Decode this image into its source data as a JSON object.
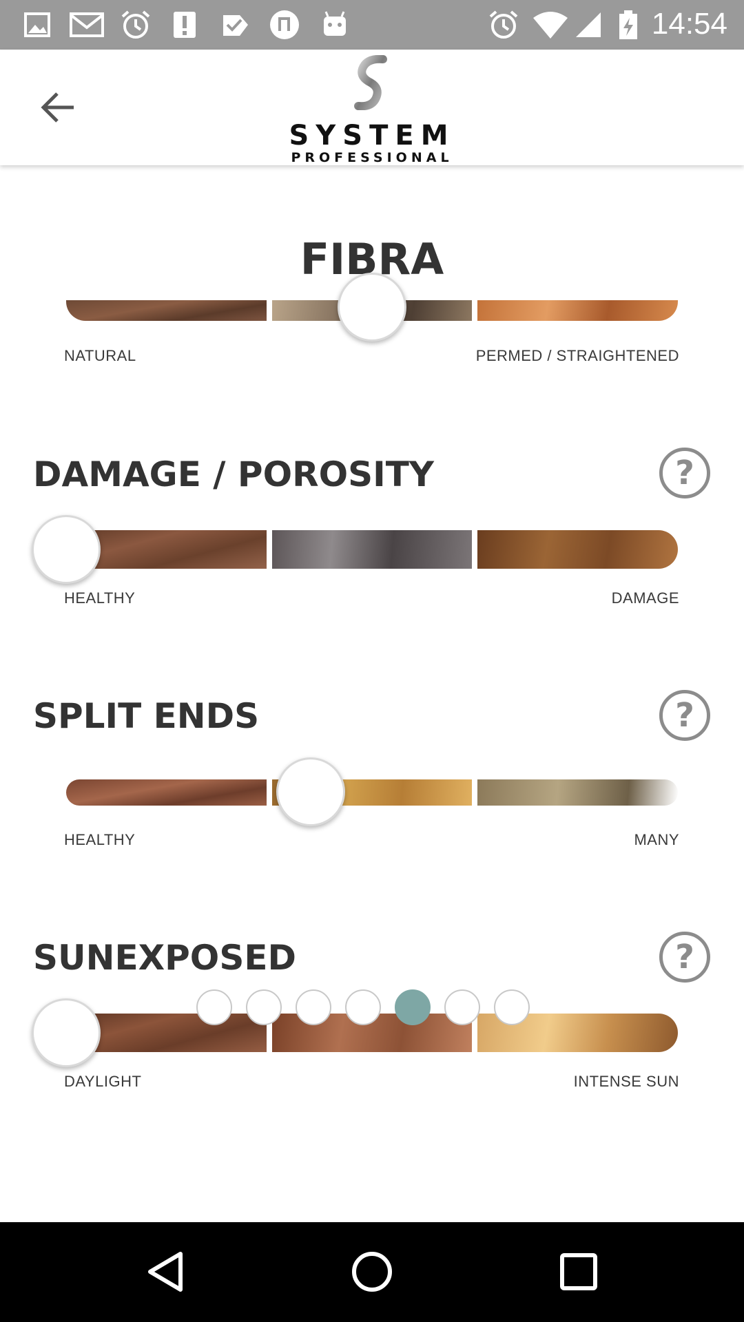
{
  "status_bar": {
    "time": "14:54",
    "left_icons": [
      "gallery-icon",
      "gmail-icon",
      "alarm-icon",
      "alert-icon",
      "check-icon",
      "music-icon",
      "android-icon"
    ],
    "right_icons": [
      "alarm-icon",
      "wifi-icon",
      "signal-icon",
      "battery-icon"
    ]
  },
  "app_bar": {
    "back_icon": "arrow-left-icon",
    "logo_line1": "SYSTEM",
    "logo_line2": "PROFESSIONAL"
  },
  "page": {
    "title": "FIBRA",
    "fibra_slider": {
      "left_label": "NATURAL",
      "right_label": "PERMED / STRAIGHTENED",
      "value_fraction": 0.5
    },
    "sections": [
      {
        "title": "DAMAGE / POROSITY",
        "left_label": "HEALTHY",
        "right_label": "DAMAGE",
        "value_fraction": 0.0,
        "help_label": "?"
      },
      {
        "title": "SPLIT ENDS",
        "left_label": "HEALTHY",
        "right_label": "MANY",
        "value_fraction": 0.4,
        "help_label": "?"
      },
      {
        "title": "SUNEXPOSED",
        "left_label": "DAYLIGHT",
        "right_label": "INTENSE SUN",
        "value_fraction": 0.0,
        "help_label": "?"
      }
    ]
  },
  "pager": {
    "total": 7,
    "active_index": 4,
    "active_color": "#7ea7a5"
  },
  "nav_bar": {
    "icons": [
      "back-triangle-icon",
      "home-circle-icon",
      "recents-square-icon"
    ]
  },
  "colors": {
    "status_bar": "#9a9a9a",
    "title_text": "#333333",
    "help_ring": "#8c8c8c",
    "nav_bar": "#000000"
  }
}
